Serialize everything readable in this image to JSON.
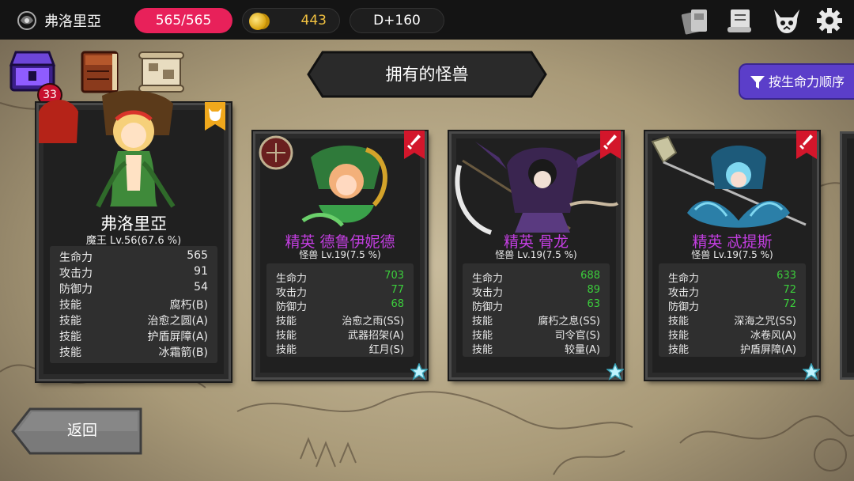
{
  "player": {
    "name": "弗洛里亞",
    "hp": "565/565",
    "gold": "443",
    "day": "D+160"
  },
  "badge_count": "33",
  "title": "拥有的怪兽",
  "sort_label": "按生命力顺序",
  "back_label": "返回",
  "colors": {
    "hp": "#e8215a",
    "gold": "#f0c040",
    "elite_name": "#c23ee0",
    "stat_green": "#3ccf3c",
    "sort_bg": "#5b3ec9"
  },
  "cards": [
    {
      "name": "弗洛里亞",
      "sub": "魔王 Lv.56(67.6 %)",
      "ribbon": "beast-face-icon",
      "stats": [
        {
          "label": "生命力",
          "value": "565"
        },
        {
          "label": "攻击力",
          "value": "91"
        },
        {
          "label": "防御力",
          "value": "54"
        },
        {
          "label": "技能",
          "value": "腐朽(B)"
        },
        {
          "label": "技能",
          "value": "治愈之圆(A)"
        },
        {
          "label": "技能",
          "value": "护盾屏障(A)"
        },
        {
          "label": "技能",
          "value": "冰霜箭(B)"
        }
      ]
    },
    {
      "name": "精英 德鲁伊妮德",
      "sub": "怪兽 Lv.19(7.5 %)",
      "ribbon": "sword-icon",
      "equip": "shield-icon",
      "stats": [
        {
          "label": "生命力",
          "value": "703"
        },
        {
          "label": "攻击力",
          "value": "77"
        },
        {
          "label": "防御力",
          "value": "68"
        },
        {
          "label": "技能",
          "value": "治愈之雨(SS)"
        },
        {
          "label": "技能",
          "value": "武器招架(A)"
        },
        {
          "label": "技能",
          "value": "红月(S)"
        }
      ]
    },
    {
      "name": "精英 骨龙",
      "sub": "怪兽 Lv.19(7.5 %)",
      "ribbon": "sword-icon",
      "equip": "sword-icon",
      "stats": [
        {
          "label": "生命力",
          "value": "688"
        },
        {
          "label": "攻击力",
          "value": "89"
        },
        {
          "label": "防御力",
          "value": "63"
        },
        {
          "label": "技能",
          "value": "腐朽之息(SS)"
        },
        {
          "label": "技能",
          "value": "司令官(S)"
        },
        {
          "label": "技能",
          "value": "较量(A)"
        }
      ]
    },
    {
      "name": "精英 忒提斯",
      "sub": "怪兽 Lv.19(7.5 %)",
      "ribbon": "sword-icon",
      "equip": "helmet-icon",
      "stats": [
        {
          "label": "生命力",
          "value": "633"
        },
        {
          "label": "攻击力",
          "value": "72"
        },
        {
          "label": "防御力",
          "value": "72"
        },
        {
          "label": "技能",
          "value": "深海之咒(SS)"
        },
        {
          "label": "技能",
          "value": "冰卷风(A)"
        },
        {
          "label": "技能",
          "value": "护盾屏障(A)"
        }
      ]
    }
  ]
}
